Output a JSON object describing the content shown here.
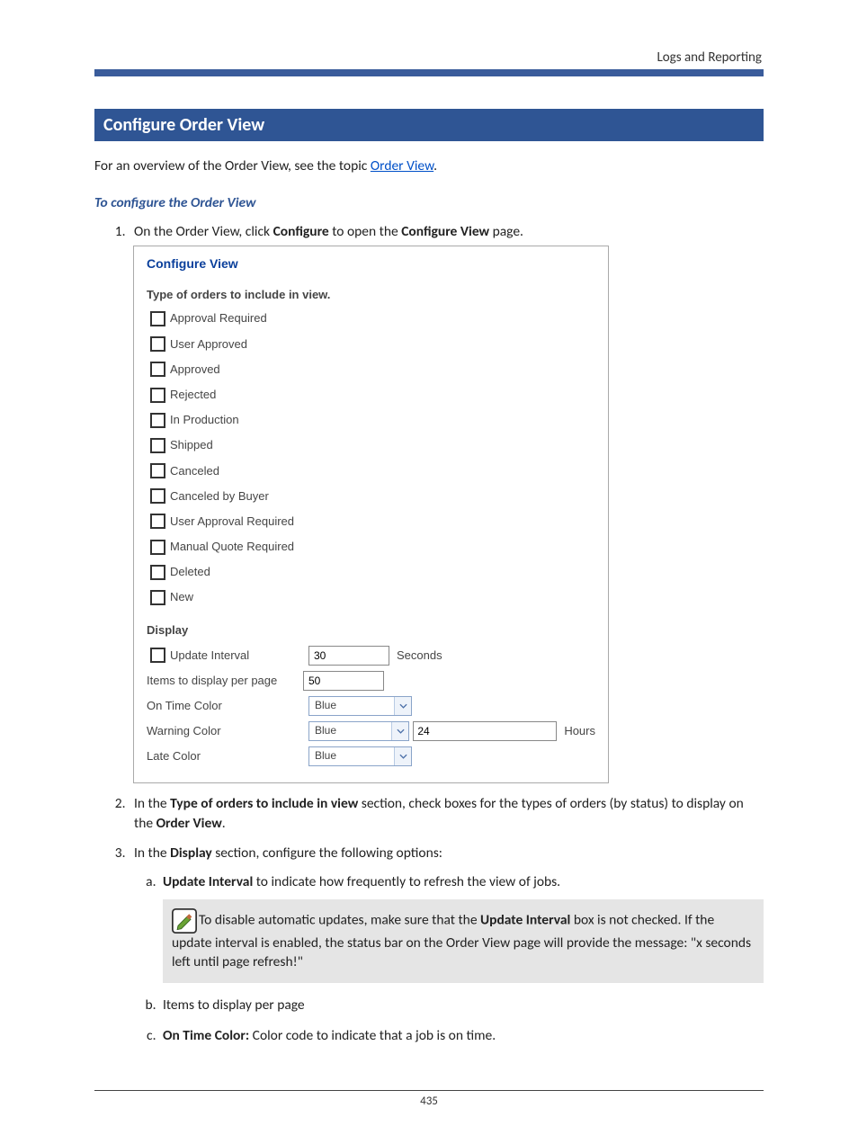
{
  "header": {
    "right": "Logs and Reporting"
  },
  "sectionTitle": "Configure Order View",
  "intro": {
    "pre": "For an overview of the Order View, see the topic ",
    "link": "Order View",
    "post": "."
  },
  "subheading": "To configure the Order View",
  "step1": {
    "pre": "On the Order View, click ",
    "b1": "Configure",
    "mid": " to open the ",
    "b2": "Configure View",
    "post": " page."
  },
  "figure": {
    "title": "Configure View",
    "typeHeader": "Type of orders to include in view.",
    "checks": [
      "Approval Required",
      "User Approved",
      "Approved",
      "Rejected",
      "In Production",
      "Shipped",
      "Canceled",
      "Canceled by Buyer",
      "User Approval Required",
      "Manual Quote Required",
      "Deleted",
      "New"
    ],
    "displayHeader": "Display",
    "updateInterval": {
      "label": "Update Interval",
      "value": "30",
      "suffix": "Seconds"
    },
    "itemsPerPage": {
      "label": "Items to display per page",
      "value": "50"
    },
    "onTimeColor": {
      "label": "On Time Color",
      "value": "Blue"
    },
    "warningColor": {
      "label": "Warning Color",
      "value": "Blue",
      "hoursValue": "24",
      "hoursSuffix": "Hours"
    },
    "lateColor": {
      "label": "Late Color",
      "value": "Blue"
    }
  },
  "step2": {
    "pre": "In the ",
    "b1": "Type of orders to include in view",
    "mid": " section, check boxes for the types of orders (by status) to display on the ",
    "b2": "Order View",
    "post": "."
  },
  "step3": {
    "pre": "In the ",
    "b1": "Display",
    "post": " section, configure the following options:"
  },
  "step3a": {
    "b": "Update Interval",
    "rest": " to indicate how frequently to refresh the view of jobs."
  },
  "note": {
    "pre": "To disable automatic updates, make sure that the ",
    "b": "Update Interval",
    "post": " box is not checked. If the update interval is enabled, the status bar on the Order View page will provide the message:  \"x seconds left until page refresh!\""
  },
  "step3b": "Items to display per page",
  "step3c": {
    "b": "On Time Color:",
    "rest": " Color code to indicate that a job is on time."
  },
  "footer": {
    "page": "435"
  }
}
